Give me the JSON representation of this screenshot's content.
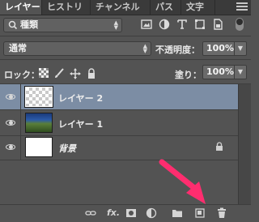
{
  "tabs": [
    {
      "label": "レイヤー",
      "active": true
    },
    {
      "label": "ヒストリー",
      "active": false
    },
    {
      "label": "チャンネル",
      "active": false
    },
    {
      "label": "パス",
      "active": false
    },
    {
      "label": "文字",
      "active": false
    }
  ],
  "filter": {
    "search_icon": "search-icon",
    "kind_label": "種類",
    "icons": [
      "image-filter-icon",
      "adjustment-filter-icon",
      "type-filter-icon",
      "shape-filter-icon",
      "smart-object-filter-icon"
    ]
  },
  "blend": {
    "mode": "通常",
    "opacity_label": "不透明度：",
    "opacity_value": "100%"
  },
  "lock": {
    "label": "ロック：",
    "icons": [
      "lock-transparency-icon",
      "lock-image-icon",
      "lock-position-icon",
      "lock-all-icon"
    ],
    "fill_label": "塗り：",
    "fill_value": "100%"
  },
  "layers": [
    {
      "name": "レイヤー 2",
      "selected": true,
      "thumbnail": "transparent",
      "locked": false
    },
    {
      "name": "レイヤー 1",
      "selected": false,
      "thumbnail": "landscape",
      "locked": false
    },
    {
      "name": "背景",
      "selected": false,
      "thumbnail": "white",
      "locked": true
    }
  ],
  "bottom_icons": [
    "link-icon",
    "fx-icon",
    "mask-icon",
    "adjustment-icon",
    "folder-icon",
    "new-layer-icon",
    "trash-icon"
  ],
  "bottom_text": {
    "fx": "fx."
  },
  "colors": {
    "panel_bg": "#535353",
    "selected_row": "#7c8da4",
    "annotation_arrow": "#ff2d6f"
  }
}
